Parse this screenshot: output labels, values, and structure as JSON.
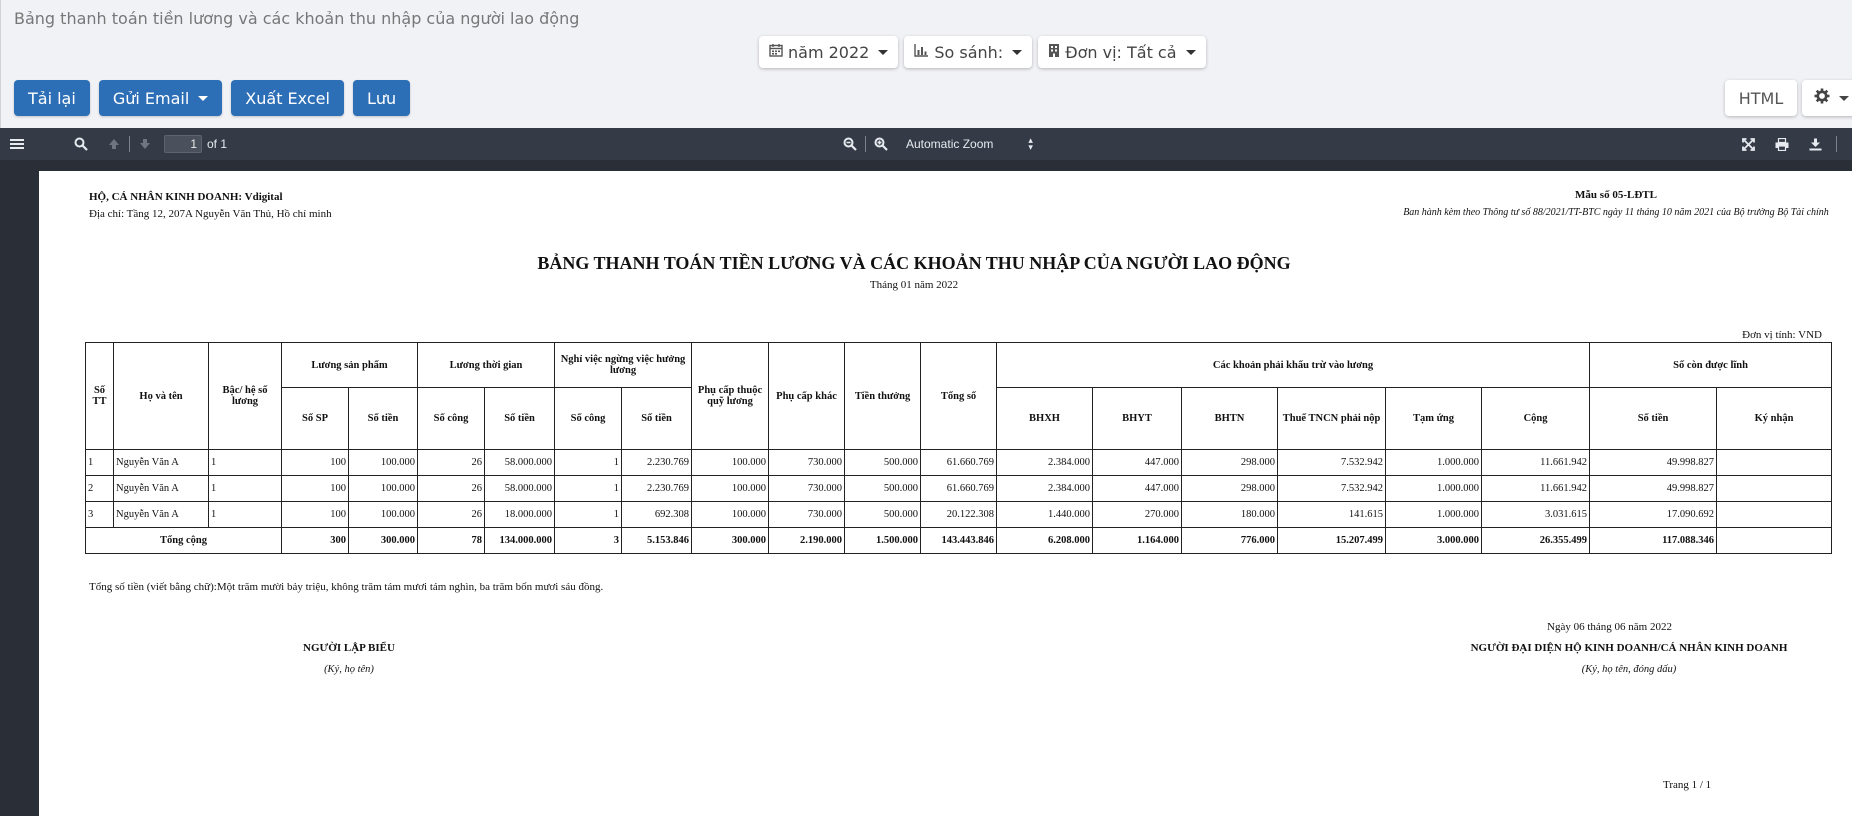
{
  "app": {
    "title": "Bảng thanh toán tiền lương và các khoản thu nhập của người lao động"
  },
  "filters": [
    {
      "icon": "calendar-icon",
      "label": "năm 2022"
    },
    {
      "icon": "bar-chart-icon",
      "label": "So sánh:"
    },
    {
      "icon": "building-icon",
      "label": "Đơn vị: Tất cả"
    }
  ],
  "actions": {
    "reload": "Tải lại",
    "send_email": "Gửi Email",
    "export_excel": "Xuất Excel",
    "save": "Lưu",
    "html": "HTML"
  },
  "viewer": {
    "page_value": "1",
    "page_total": "of 1",
    "zoom": "Automatic Zoom"
  },
  "doc": {
    "company": "HỘ, CÁ NHÂN KINH DOANH: Vdigital",
    "address": "Địa chỉ: Tầng 12, 207A Nguyễn Văn Thủ, Hồ chí minh",
    "form_no": "Mẫu số 05-LĐTL",
    "form_note": "Ban hành kèm theo Thông tư số 88/2021/TT-BTC ngày 11 tháng 10 năm 2021 của Bộ trưởng Bộ Tài chính",
    "title": "BẢNG THANH TOÁN TIỀN LƯƠNG VÀ CÁC KHOẢN THU NHẬP CỦA NGƯỜI LAO ĐỘNG",
    "subtitle": "Tháng 01 năm 2022",
    "unit": "Đơn vị tính: VND",
    "headers": {
      "stt": "Số TT",
      "name": "Họ và tên",
      "grade": "Bậc/ hệ số lương",
      "product_wage": "Lương sản phẩm",
      "time_wage": "Lương thời gian",
      "leave_pay": "Nghỉ việc ngừng việc hưởng lương",
      "dep_allowance": "Phụ cấp thuộc quỹ lương",
      "other_allowance": "Phụ cấp khác",
      "bonus": "Tiền thưởng",
      "total": "Tổng số",
      "deductions": "Các khoản phải khấu trừ vào lương",
      "remaining": "Số còn được lĩnh",
      "so_sp": "Số SP",
      "so_tien": "Số tiền",
      "so_cong": "Số công",
      "bhxh": "BHXH",
      "bhyt": "BHYT",
      "bhtn": "BHTN",
      "tncn": "Thuế TNCN phải nộp",
      "advance": "Tạm ứng",
      "sum": "Cộng",
      "sign": "Ký nhận"
    },
    "rows": [
      {
        "stt": "1",
        "name": "Nguyễn Văn A",
        "grade": "1",
        "sp": "100",
        "sp_amt": "100.000",
        "tg_cong": "26",
        "tg_amt": "58.000.000",
        "nv_cong": "1",
        "nv_amt": "2.230.769",
        "pc1": "100.000",
        "pc2": "730.000",
        "bonus": "500.000",
        "total": "61.660.769",
        "bhxh": "2.384.000",
        "bhyt": "447.000",
        "bhtn": "298.000",
        "tncn": "7.532.942",
        "advance": "1.000.000",
        "sum": "11.661.942",
        "remain": "49.998.827",
        "sign": ""
      },
      {
        "stt": "2",
        "name": "Nguyễn Văn A",
        "grade": "1",
        "sp": "100",
        "sp_amt": "100.000",
        "tg_cong": "26",
        "tg_amt": "58.000.000",
        "nv_cong": "1",
        "nv_amt": "2.230.769",
        "pc1": "100.000",
        "pc2": "730.000",
        "bonus": "500.000",
        "total": "61.660.769",
        "bhxh": "2.384.000",
        "bhyt": "447.000",
        "bhtn": "298.000",
        "tncn": "7.532.942",
        "advance": "1.000.000",
        "sum": "11.661.942",
        "remain": "49.998.827",
        "sign": ""
      },
      {
        "stt": "3",
        "name": "Nguyễn Văn A",
        "grade": "1",
        "sp": "100",
        "sp_amt": "100.000",
        "tg_cong": "26",
        "tg_amt": "18.000.000",
        "nv_cong": "1",
        "nv_amt": "692.308",
        "pc1": "100.000",
        "pc2": "730.000",
        "bonus": "500.000",
        "total": "20.122.308",
        "bhxh": "1.440.000",
        "bhyt": "270.000",
        "bhtn": "180.000",
        "tncn": "141.615",
        "advance": "1.000.000",
        "sum": "3.031.615",
        "remain": "17.090.692",
        "sign": ""
      }
    ],
    "totals": {
      "label": "Tổng cộng",
      "sp": "300",
      "sp_amt": "300.000",
      "tg_cong": "78",
      "tg_amt": "134.000.000",
      "nv_cong": "3",
      "nv_amt": "5.153.846",
      "pc1": "300.000",
      "pc2": "2.190.000",
      "bonus": "1.500.000",
      "total": "143.443.846",
      "bhxh": "6.208.000",
      "bhyt": "1.164.000",
      "bhtn": "776.000",
      "tncn": "15.207.499",
      "advance": "3.000.000",
      "sum": "26.355.499",
      "remain": "117.088.346",
      "sign": ""
    },
    "amount_in_words": "Tổng số tiền (viết bằng chữ):Một trăm mười bảy triệu, không trăm tám mươi tám nghìn, ba trăm bốn mươi sáu đồng.",
    "sign_date": "Ngày 06 tháng 06 năm 2022",
    "preparer_title": "NGƯỜI LẬP BIỂU",
    "preparer_note": "(Ký, họ tên)",
    "rep_title": "NGƯỜI ĐẠI DIỆN HỘ KINH DOANH/CÁ NHÂN KINH DOANH",
    "rep_note": "(Ký, họ tên, đóng dấu)",
    "page_label": "Trang 1 /  1"
  }
}
